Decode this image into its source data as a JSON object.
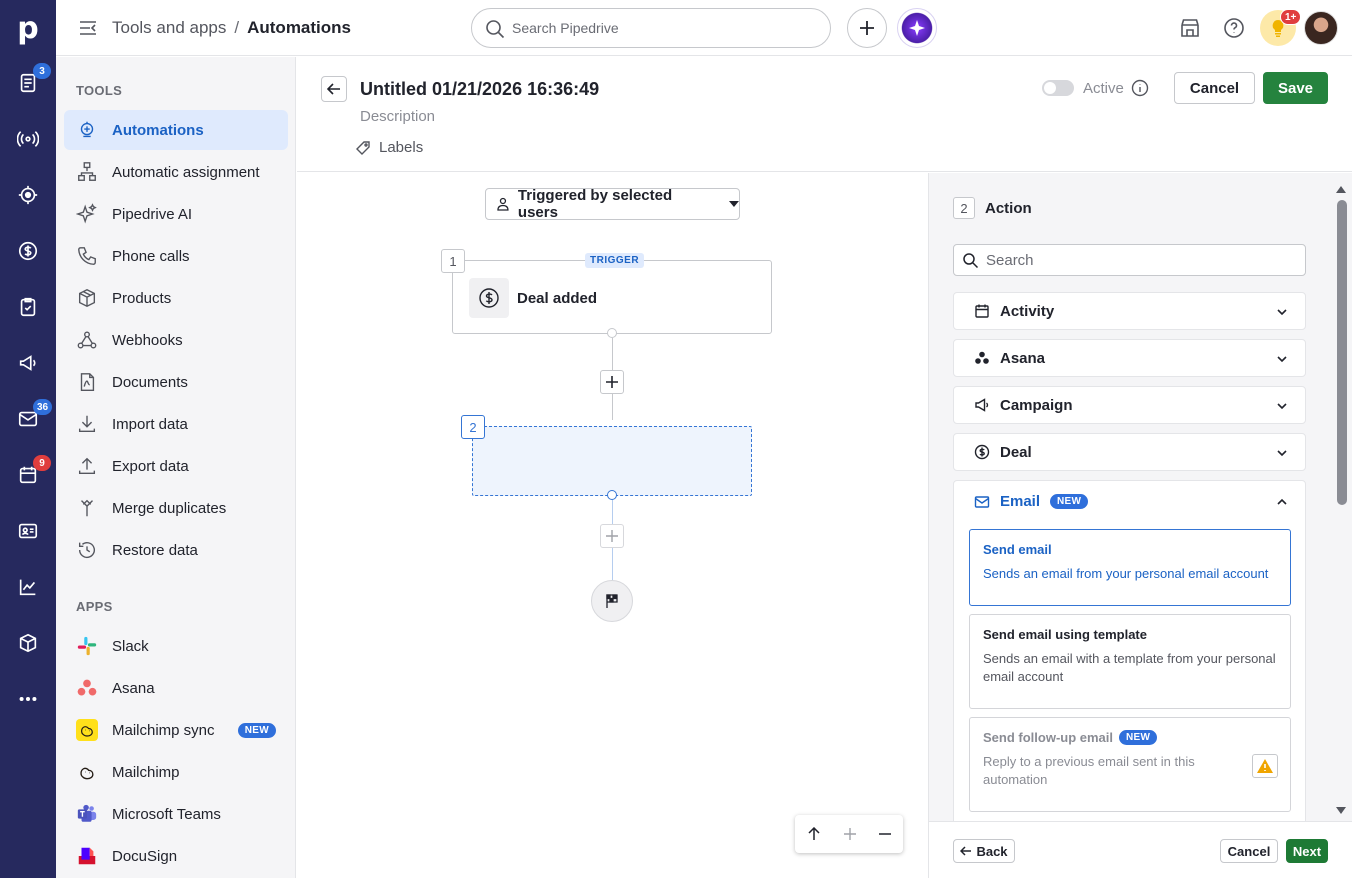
{
  "topbar": {
    "breadcrumb_parent": "Tools and apps",
    "breadcrumb_sep": "/",
    "breadcrumb_current": "Automations",
    "search_placeholder": "Search Pipedrive",
    "bulb_badge": "1+"
  },
  "rail": {
    "logo": "p",
    "items": [
      {
        "icon": "leads-icon",
        "badge": "3",
        "badge_color": "#2f6fdb"
      },
      {
        "icon": "broadcast-icon"
      },
      {
        "icon": "target-icon"
      },
      {
        "icon": "deals-icon"
      },
      {
        "icon": "tasks-icon"
      },
      {
        "icon": "campaigns-icon"
      },
      {
        "icon": "mail-icon",
        "badge": "36",
        "badge_color": "#2f6fdb"
      },
      {
        "icon": "calendar-icon",
        "badge": "9",
        "badge_color": "#e03e3e"
      },
      {
        "icon": "contacts-icon"
      },
      {
        "icon": "insights-icon"
      },
      {
        "icon": "products-icon"
      },
      {
        "icon": "more-icon"
      }
    ]
  },
  "sidebar": {
    "tools_title": "TOOLS",
    "tools": [
      {
        "label": "Automations",
        "icon": "automations-icon",
        "active": true
      },
      {
        "label": "Automatic assignment",
        "icon": "assignment-icon"
      },
      {
        "label": "Pipedrive AI",
        "icon": "sparkle-icon"
      },
      {
        "label": "Phone calls",
        "icon": "phone-icon"
      },
      {
        "label": "Products",
        "icon": "box-icon"
      },
      {
        "label": "Webhooks",
        "icon": "webhook-icon"
      },
      {
        "label": "Documents",
        "icon": "document-icon"
      },
      {
        "label": "Import data",
        "icon": "download-icon"
      },
      {
        "label": "Export data",
        "icon": "upload-icon"
      },
      {
        "label": "Merge duplicates",
        "icon": "merge-icon"
      },
      {
        "label": "Restore data",
        "icon": "restore-icon"
      }
    ],
    "apps_title": "APPS",
    "apps": [
      {
        "label": "Slack",
        "icon": "slack-logo-icon"
      },
      {
        "label": "Asana",
        "icon": "asana-logo-icon"
      },
      {
        "label": "Mailchimp sync",
        "icon": "mailchimp-logo-icon",
        "badge": "NEW"
      },
      {
        "label": "Mailchimp",
        "icon": "mailchimp-logo-icon"
      },
      {
        "label": "Microsoft Teams",
        "icon": "teams-logo-icon"
      },
      {
        "label": "DocuSign",
        "icon": "docusign-logo-icon"
      }
    ]
  },
  "editor": {
    "title": "Untitled 01/21/2026 16:36:49",
    "description_placeholder": "Description",
    "labels": "Labels",
    "active_label": "Active",
    "cancel": "Cancel",
    "save": "Save"
  },
  "canvas": {
    "trigger_select": "Triggered by selected users",
    "step1_num": "1",
    "trigger_tag": "TRIGGER",
    "trigger_label": "Deal added",
    "step2_num": "2"
  },
  "panel": {
    "step_num": "2",
    "title": "Action",
    "search_placeholder": "Search",
    "categories": [
      {
        "label": "Activity",
        "icon": "calendar-icon"
      },
      {
        "label": "Asana",
        "icon": "asana-icon"
      },
      {
        "label": "Campaign",
        "icon": "megaphone-icon"
      },
      {
        "label": "Deal",
        "icon": "dollar-icon"
      }
    ],
    "email": {
      "label": "Email",
      "badge": "NEW",
      "options": [
        {
          "title": "Send email",
          "desc": "Sends an email from your personal email account"
        },
        {
          "title": "Send email using template",
          "desc": "Sends an email with a template from your personal email account"
        },
        {
          "title": "Send follow-up email",
          "badge": "NEW",
          "desc": "Reply to a previous email sent in this automation"
        }
      ]
    },
    "back": "Back",
    "cancel": "Cancel",
    "next": "Next"
  },
  "colors": {
    "rail": "#26295e",
    "accent": "#1b62c4",
    "save_green": "#25833e",
    "next_green": "#1e7a35"
  }
}
